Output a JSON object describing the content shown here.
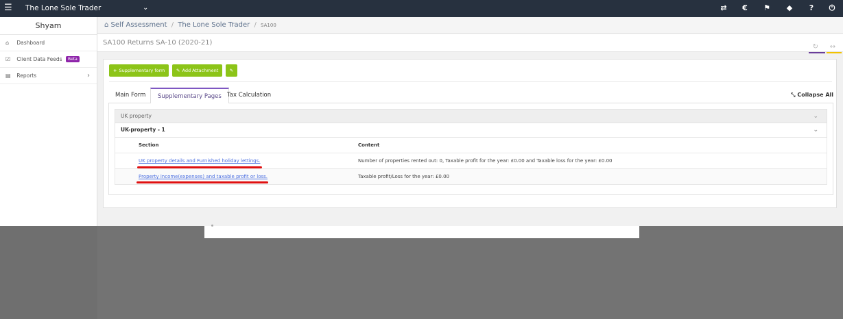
{
  "topbar": {
    "brand": "The Lone Sole Trader",
    "icons": [
      "transfer-icon",
      "currency-icon",
      "megaphone-icon",
      "tag-icon",
      "help-icon",
      "power-icon"
    ]
  },
  "sidebar": {
    "user": "Shyam",
    "items": [
      {
        "label": "Dashboard",
        "icon": "home-icon"
      },
      {
        "label": "Client Data Feeds",
        "badge": "Beta",
        "icon": "checkbox-icon"
      },
      {
        "label": "Reports",
        "icon": "file-icon"
      }
    ]
  },
  "breadcrumb": {
    "home": "Self Assessment",
    "client": "The Lone Sole Trader",
    "current": "SA100"
  },
  "page": {
    "title": "SA100 Returns SA-10 (2020-21)"
  },
  "buttons": {
    "supplementary": "Supplementary form",
    "attachment": "Add Attachment"
  },
  "tabs": {
    "main": "Main Form",
    "supplementary": "Supplementary Pages",
    "tax": "Tax Calculation",
    "collapse": "Collapse All"
  },
  "section": {
    "title": "UK property",
    "sub_title": "UK-property - 1",
    "col_section": "Section",
    "col_content": "Content",
    "rows": [
      {
        "section": "UK property details and Furnished holiday lettings.",
        "content": "Number of properties rented out: 0, Taxable profit for the year: £0.00 and Taxable loss for the year: £0.00"
      },
      {
        "section": "Property income(expenses) and taxable profit or loss.",
        "content": "Taxable profit/Loss for the year: £0.00"
      }
    ]
  },
  "colors": {
    "accent": "#8cc418",
    "topbar": "#27313f",
    "tab_active": "#7e57c2",
    "badge": "#8e24aa",
    "annotation": "#e01010"
  }
}
